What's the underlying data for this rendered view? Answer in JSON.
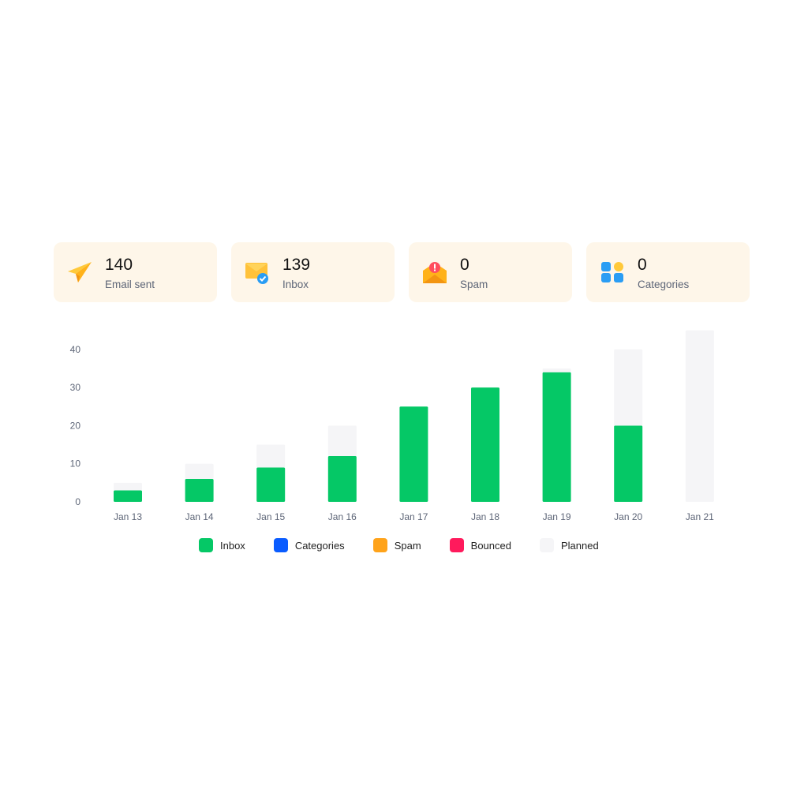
{
  "stats": [
    {
      "icon": "paper-plane-icon",
      "value": "140",
      "label": "Email sent"
    },
    {
      "icon": "envelope-check-icon",
      "value": "139",
      "label": "Inbox"
    },
    {
      "icon": "envelope-alert-icon",
      "value": "0",
      "label": "Spam"
    },
    {
      "icon": "grid-categories-icon",
      "value": "0",
      "label": "Categories"
    }
  ],
  "colors": {
    "inbox": "#05c866",
    "categories": "#0a5cff",
    "spam": "#ffa31a",
    "bounced": "#ff1a5c",
    "planned": "#f5f5f7",
    "card_bg": "#fef6e9"
  },
  "chart_data": {
    "type": "bar",
    "stacked": true,
    "title": "",
    "xlabel": "",
    "ylabel": "",
    "ylim": [
      0,
      45
    ],
    "yticks": [
      0,
      10,
      20,
      30,
      40
    ],
    "grid": false,
    "legend_position": "bottom-center",
    "categories": [
      "Jan 13",
      "Jan 14",
      "Jan 15",
      "Jan 16",
      "Jan 17",
      "Jan 18",
      "Jan 19",
      "Jan 20",
      "Jan 21"
    ],
    "series": [
      {
        "name": "Inbox",
        "key": "inbox",
        "values": [
          3,
          6,
          9,
          12,
          25,
          30,
          34,
          20,
          0
        ]
      },
      {
        "name": "Categories",
        "key": "categories",
        "values": [
          0,
          0,
          0,
          0,
          0,
          0,
          0,
          0,
          0
        ]
      },
      {
        "name": "Spam",
        "key": "spam",
        "values": [
          0,
          0,
          0,
          0,
          0,
          0,
          0,
          0,
          0
        ]
      },
      {
        "name": "Bounced",
        "key": "bounced",
        "values": [
          0,
          0,
          0,
          0,
          0,
          0,
          0,
          0,
          0
        ]
      },
      {
        "name": "Planned",
        "key": "planned",
        "values": [
          2,
          4,
          6,
          8,
          0,
          0,
          1,
          20,
          45
        ]
      }
    ]
  }
}
